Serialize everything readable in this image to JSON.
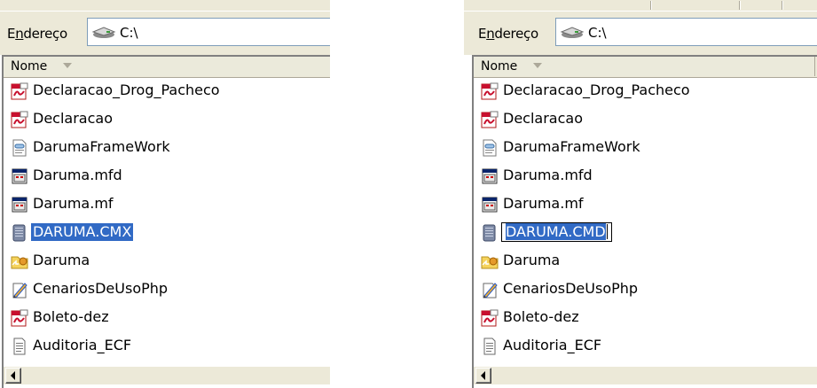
{
  "windows": [
    {
      "address_label_prefix": "E",
      "address_label_accel": "n",
      "address_label_suffix": "dereço",
      "address_value": "C:\\",
      "column_name": "Nome",
      "files": [
        {
          "name": "Declaracao_Drog_Pacheco",
          "icon": "pdf-icon"
        },
        {
          "name": "Declaracao",
          "icon": "pdf-icon"
        },
        {
          "name": "DarumaFrameWork",
          "icon": "config-file-icon"
        },
        {
          "name": "Daruma.mfd",
          "icon": "window-file-icon"
        },
        {
          "name": "Daruma.mf",
          "icon": "window-file-icon"
        },
        {
          "name": "DARUMA.CMX",
          "icon": "generic-file-icon",
          "state": "selected"
        },
        {
          "name": "Daruma",
          "icon": "folder-shortcut-icon"
        },
        {
          "name": "CenariosDeUsoPhp",
          "icon": "pen-file-icon"
        },
        {
          "name": "Boleto-dez",
          "icon": "pdf-icon"
        },
        {
          "name": "Auditoria_ECF",
          "icon": "text-file-icon"
        }
      ]
    },
    {
      "address_label_prefix": "E",
      "address_label_accel": "n",
      "address_label_suffix": "dereço",
      "address_value": "C:\\",
      "column_name": "Nome",
      "files": [
        {
          "name": "Declaracao_Drog_Pacheco",
          "icon": "pdf-icon"
        },
        {
          "name": "Declaracao",
          "icon": "pdf-icon"
        },
        {
          "name": "DarumaFrameWork",
          "icon": "config-file-icon"
        },
        {
          "name": "Daruma.mfd",
          "icon": "window-file-icon"
        },
        {
          "name": "Daruma.mf",
          "icon": "window-file-icon"
        },
        {
          "name": "DARUMA.CMD",
          "icon": "generic-file-icon",
          "state": "editing"
        },
        {
          "name": "Daruma",
          "icon": "folder-shortcut-icon"
        },
        {
          "name": "CenariosDeUsoPhp",
          "icon": "pen-file-icon"
        },
        {
          "name": "Boleto-dez",
          "icon": "pdf-icon"
        },
        {
          "name": "Auditoria_ECF",
          "icon": "text-file-icon"
        }
      ]
    }
  ],
  "colors": {
    "selection": "#316ac5",
    "chrome": "#ece9d8",
    "pdf_red": "#c8102e"
  }
}
